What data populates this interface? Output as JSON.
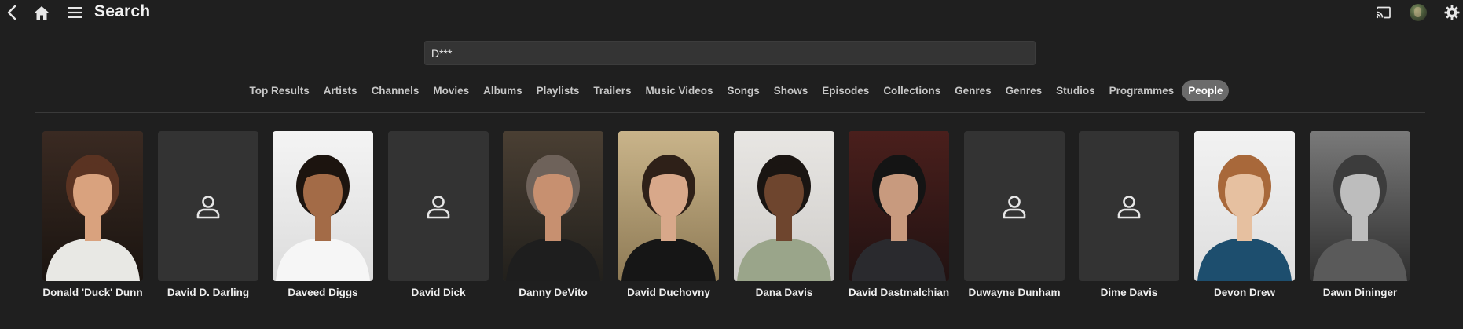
{
  "header": {
    "title": "Search",
    "back_icon": "chevron-left-icon",
    "home_icon": "home-icon",
    "menu_icon": "hamburger-menu-icon",
    "cast_icon": "cast-icon",
    "avatar_icon": "user-avatar",
    "settings_icon": "gear-icon"
  },
  "search": {
    "value": "D***"
  },
  "tabs": [
    {
      "label": "Top Results",
      "active": false
    },
    {
      "label": "Artists",
      "active": false
    },
    {
      "label": "Channels",
      "active": false
    },
    {
      "label": "Movies",
      "active": false
    },
    {
      "label": "Albums",
      "active": false
    },
    {
      "label": "Playlists",
      "active": false
    },
    {
      "label": "Trailers",
      "active": false
    },
    {
      "label": "Music Videos",
      "active": false
    },
    {
      "label": "Songs",
      "active": false
    },
    {
      "label": "Shows",
      "active": false
    },
    {
      "label": "Episodes",
      "active": false
    },
    {
      "label": "Collections",
      "active": false
    },
    {
      "label": "Genres",
      "active": false
    },
    {
      "label": "Genres",
      "active": false
    },
    {
      "label": "Studios",
      "active": false
    },
    {
      "label": "Programmes",
      "active": false
    },
    {
      "label": "People",
      "active": true
    }
  ],
  "people": [
    {
      "name": "Donald 'Duck' Dunn",
      "has_photo": true
    },
    {
      "name": "David D. Darling",
      "has_photo": false
    },
    {
      "name": "Daveed Diggs",
      "has_photo": true
    },
    {
      "name": "David Dick",
      "has_photo": false
    },
    {
      "name": "Danny DeVito",
      "has_photo": true
    },
    {
      "name": "David Duchovny",
      "has_photo": true
    },
    {
      "name": "Dana Davis",
      "has_photo": true
    },
    {
      "name": "David Dastmalchian",
      "has_photo": true
    },
    {
      "name": "Duwayne Dunham",
      "has_photo": false
    },
    {
      "name": "Dime Davis",
      "has_photo": false
    },
    {
      "name": "Devon Drew",
      "has_photo": true
    },
    {
      "name": "Dawn Dininger",
      "has_photo": true
    }
  ],
  "colors": {
    "background": "#1f1f1f",
    "active_tab": "#6b6b6b",
    "placeholder_tile": "#333333"
  }
}
